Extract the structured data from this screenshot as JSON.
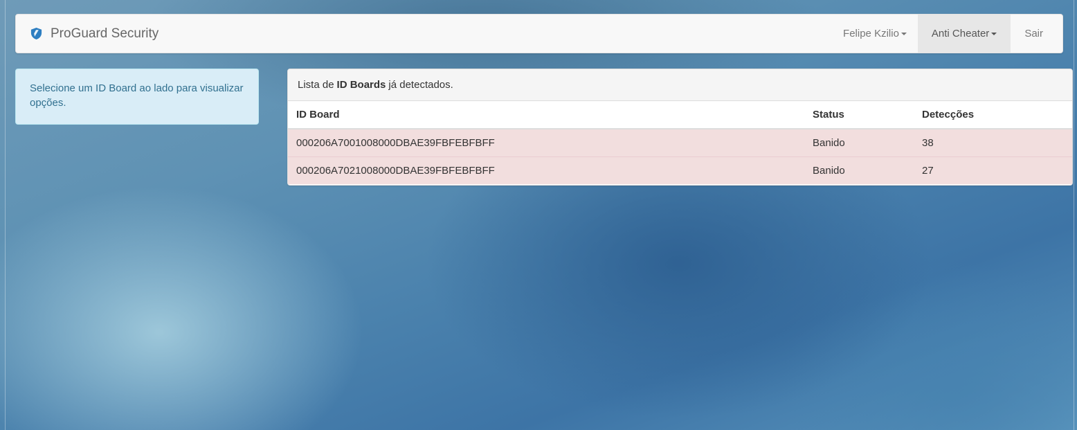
{
  "navbar": {
    "brand": "ProGuard Security",
    "brand_icon": "shield-icon",
    "user_menu": "Felipe Kzilio",
    "anticheat_menu": "Anti Cheater",
    "logout": "Sair"
  },
  "info_box": {
    "text": "Selecione um ID Board ao lado para visualizar opções."
  },
  "panel": {
    "heading_prefix": "Lista de",
    "heading_bold": "ID Boards",
    "heading_suffix": "já detectados.",
    "columns": {
      "id_board": "ID Board",
      "status": "Status",
      "detections": "Detecções"
    },
    "rows": [
      {
        "id_board": "000206A7001008000DBAE39FBFEBFBFF",
        "status": "Banido",
        "detections": "38"
      },
      {
        "id_board": "000206A7021008000DBAE39FBFEBFBFF",
        "status": "Banido",
        "detections": "27"
      }
    ]
  },
  "colors": {
    "accent_shield": "#2d7ec1",
    "danger_row": "#f2dede",
    "info_bg": "#d9edf7",
    "info_text": "#31708f"
  }
}
